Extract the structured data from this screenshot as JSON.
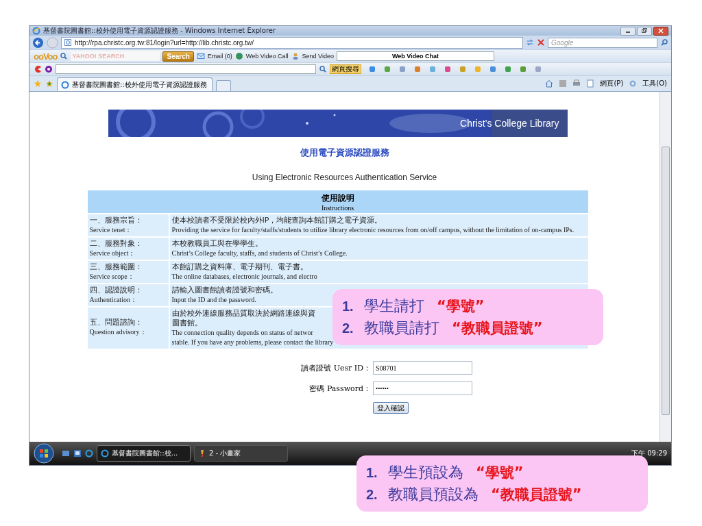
{
  "window": {
    "title": "基督書院圖書館::校外使用電子資源認證服務 - Windows Internet Explorer"
  },
  "address_bar": {
    "url": "http://rpa.christc.org.tw:81/login?url=http://lib.christc.org.tw/"
  },
  "search_box": {
    "placeholder": "Google"
  },
  "toolbar": {
    "logo": "ooVoo",
    "search_placeholder": "YAHOO! SEARCH",
    "search_button": "Search",
    "email": "Email (0)",
    "video_call": "Web Video Call",
    "send_video": "Send Video",
    "chat_field": "Web Video Chat",
    "web_search": "網頁搜尋"
  },
  "tab": {
    "label": "基督書院圖書館::校外使用電子資源認證服務"
  },
  "command_bar": [
    "網頁(P)",
    "工具(O)"
  ],
  "page": {
    "banner_caption": "Christ’s College Library",
    "heading": "使用電子資源認證服務",
    "subtitle": "Using Electronic Resources Authentication Service",
    "table": {
      "title": "使用說明",
      "subtitle": "Instructions",
      "rows": [
        {
          "label_zh": "一、服務宗旨：",
          "label_en": "Service tenet：",
          "text_zh": "使本校讀者不受限於校內外IP，均能查詢本館訂購之電子資源。",
          "text_en": [
            "Providing the service for faculty/staffs/students to utilize library electronic resources from on/off campus, without the limitation of on-campus IPs."
          ]
        },
        {
          "label_zh": "二、服務對象：",
          "label_en": "Service object：",
          "text_zh": "本校教職員工與在學學生。",
          "text_en": [
            "Christ’s College faculty, staffs, and students of Christ’s College."
          ]
        },
        {
          "label_zh": "三、服務範圍：",
          "label_en": "Service scope：",
          "text_zh": "本館訂購之資料庫、電子期刊、電子書。",
          "text_en": [
            "The online databases, electronic journals, and electro"
          ]
        },
        {
          "label_zh": "四、認證說明：",
          "label_en": "Authentication：",
          "text_zh": "請輸入圖書館讀者證號和密碼。",
          "text_en": [
            "Input the ID and the password."
          ]
        },
        {
          "label_zh": "五、問題諮詢：",
          "label_en": "Question advisory：",
          "text_zh": "由於校外連線服務品質取決於網路連線與資",
          "text_zh_2": "圖書館。",
          "text_en": [
            "The connection quality depends on status of networ",
            "stable.  If you have any problems, please contact the library"
          ]
        }
      ]
    },
    "form": {
      "user_label": "讀者證號 Uesr ID：",
      "user_value": "S08701",
      "password_label": "密碼 Password：",
      "password_value": "••••••",
      "submit": "登入確認"
    }
  },
  "taskbar": {
    "items": [
      {
        "label": "基督書院圖書館::校...",
        "selected": true
      },
      {
        "label": "2 - 小畫家",
        "selected": false
      }
    ],
    "clock": "下午 09:29"
  },
  "callouts": [
    {
      "lines": [
        {
          "number": "1.",
          "text": "學生請打",
          "quote": "“學號”"
        },
        {
          "number": "2.",
          "text": "教職員請打",
          "quote": "“教職員證號”"
        }
      ]
    },
    {
      "lines": [
        {
          "number": "1.",
          "text": "學生預設為",
          "quote": "“學號”"
        },
        {
          "number": "2.",
          "text": "教職員預設為",
          "quote": "“教職員證號”"
        }
      ]
    }
  ]
}
